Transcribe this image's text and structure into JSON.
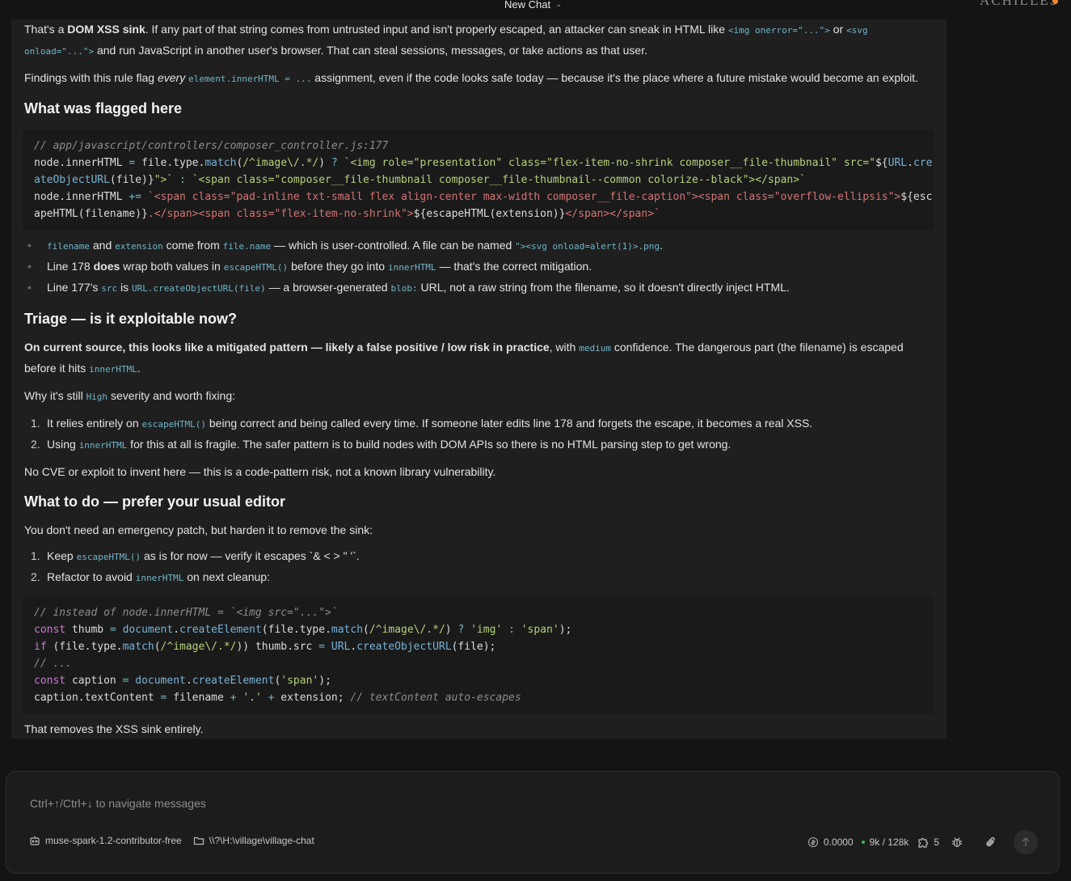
{
  "topbar": {
    "title": "New Chat",
    "brand": "ACHILLES"
  },
  "message": {
    "intro": {
      "p1_a": "That's a ",
      "p1_b": "DOM XSS sink",
      "p1_c": ". If any part of that string comes from untrusted input and isn't properly escaped, an attacker can sneak in HTML like ",
      "p1_code1": "<img onerror=\"...\">",
      "p1_d": " or ",
      "p1_code2": "<svg onload=\"...\">",
      "p1_e": " and run JavaScript in another user's browser. That can steal sessions, messages, or take actions as that user.",
      "p2_a": "Findings with this rule flag ",
      "p2_b": "every",
      "p2_code": "element.innerHTML = ...",
      "p2_c": " assignment, even if the code looks safe today — because it's the place where a future mistake would become an exploit."
    },
    "section1": {
      "heading": "What was flagged here",
      "code_comment": "// app/javascript/controllers/composer_controller.js:177",
      "bullets": {
        "b1_code1": "filename",
        "b1_a": " and ",
        "b1_code2": "extension",
        "b1_b": " come from ",
        "b1_code3": "file.name",
        "b1_c": " — which is user-controlled. A file can be named ",
        "b1_code4": "\"><svg onload=alert(1)>.png",
        "b1_d": ".",
        "b2_a": "Line 178 ",
        "b2_b": "does",
        "b2_c": " wrap both values in ",
        "b2_code1": "escapeHTML()",
        "b2_d": " before they go into ",
        "b2_code2": "innerHTML",
        "b2_e": " — that's the correct mitigation.",
        "b3_a": "Line 177's ",
        "b3_code1": "src",
        "b3_b": " is ",
        "b3_code2": "URL.createObjectURL(file)",
        "b3_c": " — a browser-generated ",
        "b3_code3": "blob:",
        "b3_d": " URL, not a raw string from the filename, so it doesn't directly inject HTML."
      }
    },
    "section2": {
      "heading": "Triage — is it exploitable now?",
      "p1_bold": "On current source, this looks like a mitigated pattern — likely a false positive / low risk in practice",
      "p1_a": ", with ",
      "p1_code": "medium",
      "p1_b": " confidence. The dangerous part (the filename) is escaped before it hits ",
      "p1_code2": "innerHTML",
      "p1_c": ".",
      "p2_a": "Why it's still ",
      "p2_code": "High",
      "p2_b": " severity and worth fixing:",
      "items": {
        "i1_num": "1.",
        "i1_a": "It relies entirely on ",
        "i1_code": "escapeHTML()",
        "i1_b": " being correct and being called every time. If someone later edits line 178 and forgets the escape, it becomes a real XSS.",
        "i2_num": "2.",
        "i2_a": "Using ",
        "i2_code": "innerHTML",
        "i2_b": " for this at all is fragile. The safer pattern is to build nodes with DOM APIs so there is no HTML parsing step to get wrong."
      },
      "p3": "No CVE or exploit to invent here — this is a code-pattern risk, not a known library vulnerability."
    },
    "section3": {
      "heading": "What to do — prefer your usual editor",
      "p1": "You don't need an emergency patch, but harden it to remove the sink:",
      "items": {
        "i1_num": "1.",
        "i1_a": "Keep ",
        "i1_code": "escapeHTML()",
        "i1_b": " as is for now — verify it escapes `& < > \" '`.",
        "i2_num": "2.",
        "i2_a": "Refactor to avoid ",
        "i2_code": "innerHTML",
        "i2_b": " on next cleanup:"
      },
      "closing": "That removes the XSS sink entirely."
    }
  },
  "composer": {
    "placeholder": "Ctrl+↑/Ctrl+↓ to navigate messages",
    "model": "muse-spark-1.2-contributor-free",
    "path": "\\\\?\\H:\\village\\village-chat",
    "cost": "0.0000",
    "tokens": "9k / 128k",
    "plugins_count": "5"
  },
  "colors": {
    "accent_orange": "#f08a24",
    "status_green": "#3fb950",
    "code_cyan": "#6fb6c9"
  }
}
